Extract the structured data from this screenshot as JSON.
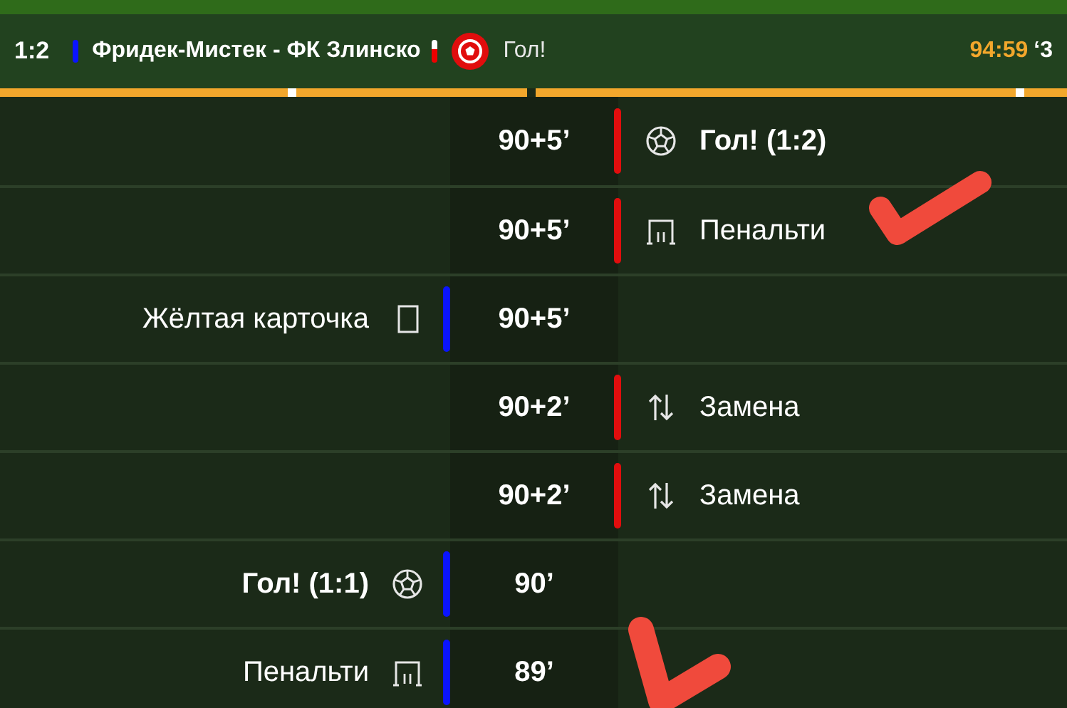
{
  "header": {
    "score": "1:2",
    "match": "Фридек-Мистек - ФК Злинско",
    "event": "Гол!",
    "clock": "94:59",
    "added_time": "‘3"
  },
  "progress": [
    {
      "level": 1
    },
    {
      "level": 1
    }
  ],
  "events": [
    {
      "home": false,
      "color": "#e10d0d",
      "time": "90+5’",
      "kind": "goal",
      "label": "Гол! (1:2)"
    },
    {
      "home": false,
      "color": "#e10d0d",
      "time": "90+5’",
      "kind": "penalty",
      "label": "Пенальти"
    },
    {
      "home": true,
      "color": "#0a14ff",
      "time": "90+5’",
      "kind": "yellow_card",
      "label": "Жёлтая карточка"
    },
    {
      "home": false,
      "color": "#e10d0d",
      "time": "90+2’",
      "kind": "substitution",
      "label": "Замена"
    },
    {
      "home": false,
      "color": "#e10d0d",
      "time": "90+2’",
      "kind": "substitution",
      "label": "Замена"
    },
    {
      "home": true,
      "color": "#0a14ff",
      "time": "90’",
      "kind": "goal",
      "label": "Гол! (1:1)"
    },
    {
      "home": true,
      "color": "#0a14ff",
      "time": "89’",
      "kind": "penalty",
      "label": "Пенальти"
    }
  ]
}
